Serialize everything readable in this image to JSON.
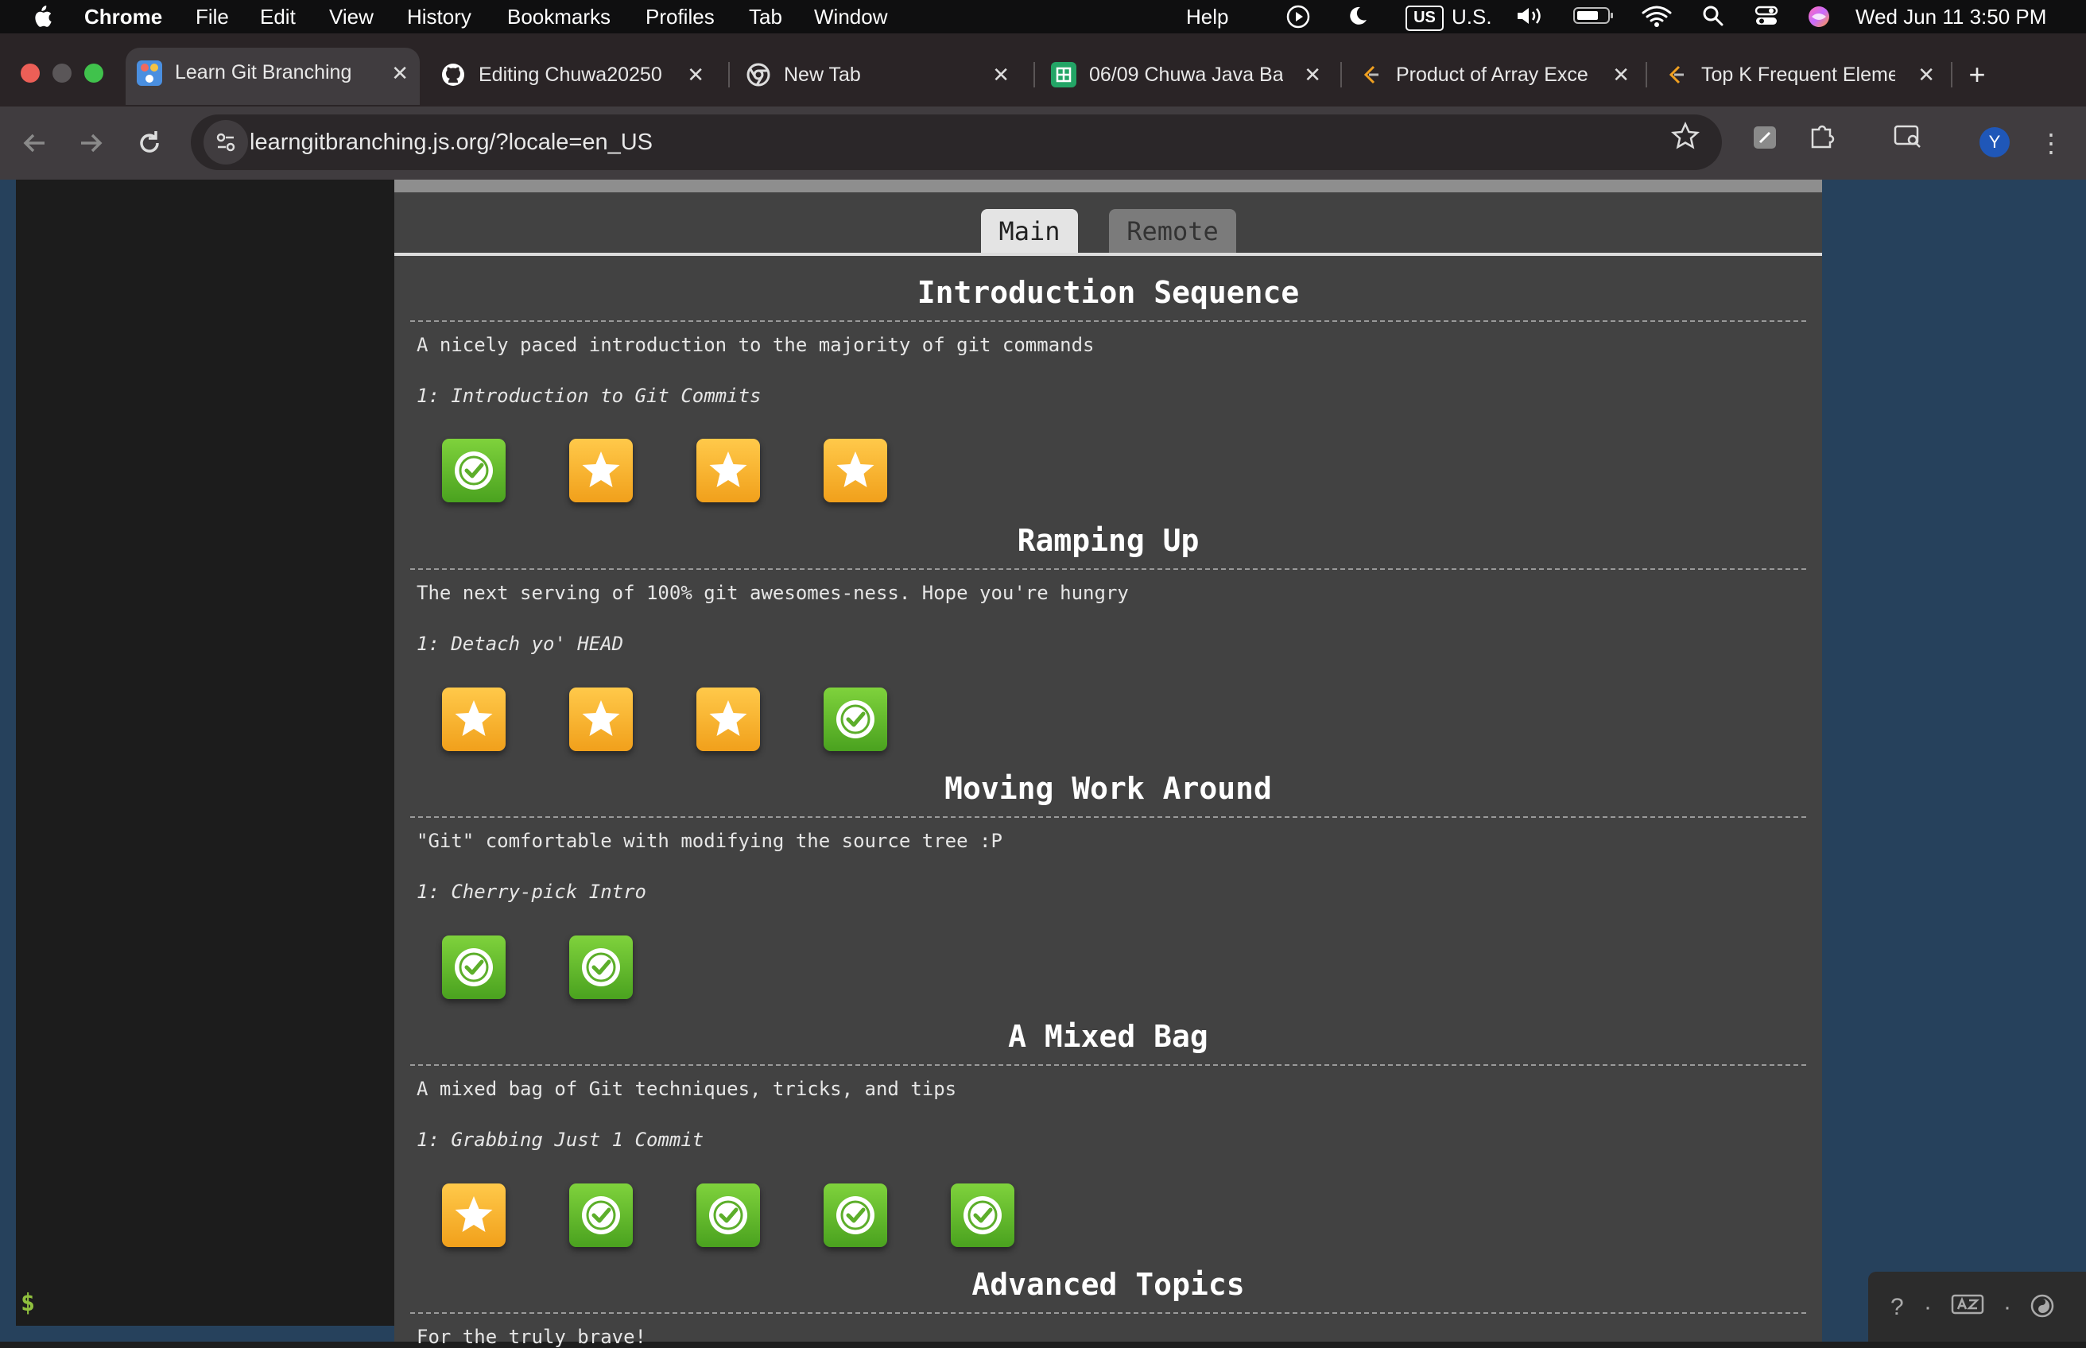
{
  "menubar": {
    "app": "Chrome",
    "items": [
      "File",
      "Edit",
      "View",
      "History",
      "Bookmarks",
      "Profiles",
      "Tab",
      "Window"
    ],
    "help": "Help",
    "input_badge": "US",
    "input_source": "U.S.",
    "datetime": "Wed Jun 11  3:50 PM"
  },
  "tabs": [
    {
      "label": "Learn Git Branching",
      "icon": "git-branching-icon",
      "active": true
    },
    {
      "label": "Editing Chuwa20250",
      "icon": "github-icon"
    },
    {
      "label": "New Tab",
      "icon": "chrome-icon"
    },
    {
      "label": "06/09 Chuwa Java Ba",
      "icon": "sheets-icon"
    },
    {
      "label": "Product of Array Exce",
      "icon": "leetcode-icon"
    },
    {
      "label": "Top K Frequent Eleme",
      "icon": "leetcode-icon"
    }
  ],
  "toolbar": {
    "url": "learngitbranching.js.org/?locale=en_US",
    "profile_initial": "Y"
  },
  "level_tabs": {
    "main": "Main",
    "remote": "Remote"
  },
  "sequences": [
    {
      "title": "Introduction Sequence",
      "description": "A nicely paced introduction to the majority of git commands",
      "level": "1: Introduction to Git Commits",
      "badges": [
        "done",
        "star",
        "star",
        "star"
      ]
    },
    {
      "title": "Ramping Up",
      "description": "The next serving of 100% git awesomes-ness. Hope you're hungry",
      "level": "1: Detach yo' HEAD",
      "badges": [
        "star",
        "star",
        "star",
        "done"
      ]
    },
    {
      "title": "Moving Work Around",
      "description": "\"Git\" comfortable with modifying the source tree :P",
      "level": "1: Cherry-pick Intro",
      "badges": [
        "done",
        "done"
      ]
    },
    {
      "title": "A Mixed Bag",
      "description": "A mixed bag of Git techniques, tricks, and tips",
      "level": "1: Grabbing Just 1 Commit",
      "badges": [
        "star",
        "done",
        "done",
        "done",
        "done"
      ]
    },
    {
      "title": "Advanced Topics",
      "description": "For the truly brave!"
    }
  ],
  "terminal": {
    "prompt": "$"
  },
  "helpbar": {
    "help": "?",
    "sep": "·"
  }
}
